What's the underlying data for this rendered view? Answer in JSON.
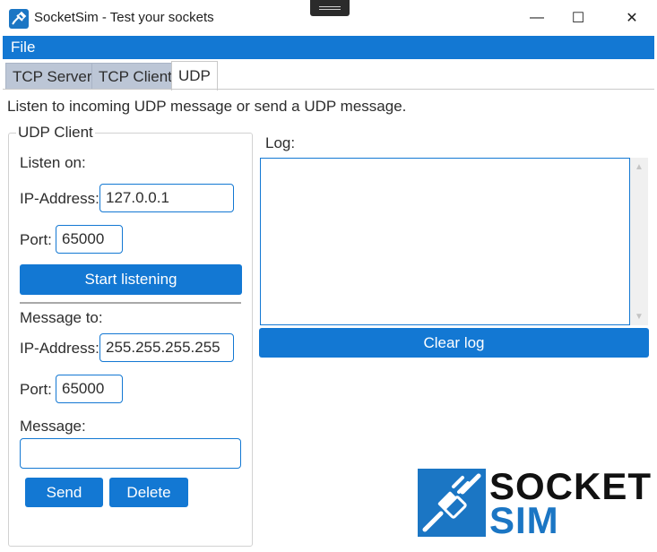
{
  "window": {
    "title": "SocketSim - Test your sockets",
    "controls": {
      "minimize": "—",
      "maximize": "☐",
      "close": "✕"
    }
  },
  "menu": {
    "file": "File"
  },
  "tabs": [
    {
      "label": "TCP Server",
      "active": false
    },
    {
      "label": "TCP Client",
      "active": false
    },
    {
      "label": "UDP",
      "active": true
    }
  ],
  "description": "Listen to incoming UDP message or send a UDP message.",
  "udp_client": {
    "title": "UDP Client",
    "listen": {
      "heading": "Listen on:",
      "ip_label": "IP-Address:",
      "ip_value": "127.0.0.1",
      "port_label": "Port:",
      "port_value": "65000",
      "start_button": "Start listening"
    },
    "send": {
      "heading": "Message to:",
      "ip_label": "IP-Address:",
      "ip_value": "255.255.255.255",
      "port_label": "Port:",
      "port_value": "65000",
      "message_label": "Message:",
      "message_value": "",
      "send_button": "Send",
      "delete_button": "Delete"
    }
  },
  "log": {
    "label": "Log:",
    "content": "",
    "clear_button": "Clear log"
  },
  "logo": {
    "line1": "SOCKET",
    "line2": "SIM",
    "icon": "socket-plug-icon"
  },
  "colors": {
    "accent": "#1378d3",
    "logo_blue": "#1b76c4",
    "tab_inactive": "#bcc6d6"
  }
}
